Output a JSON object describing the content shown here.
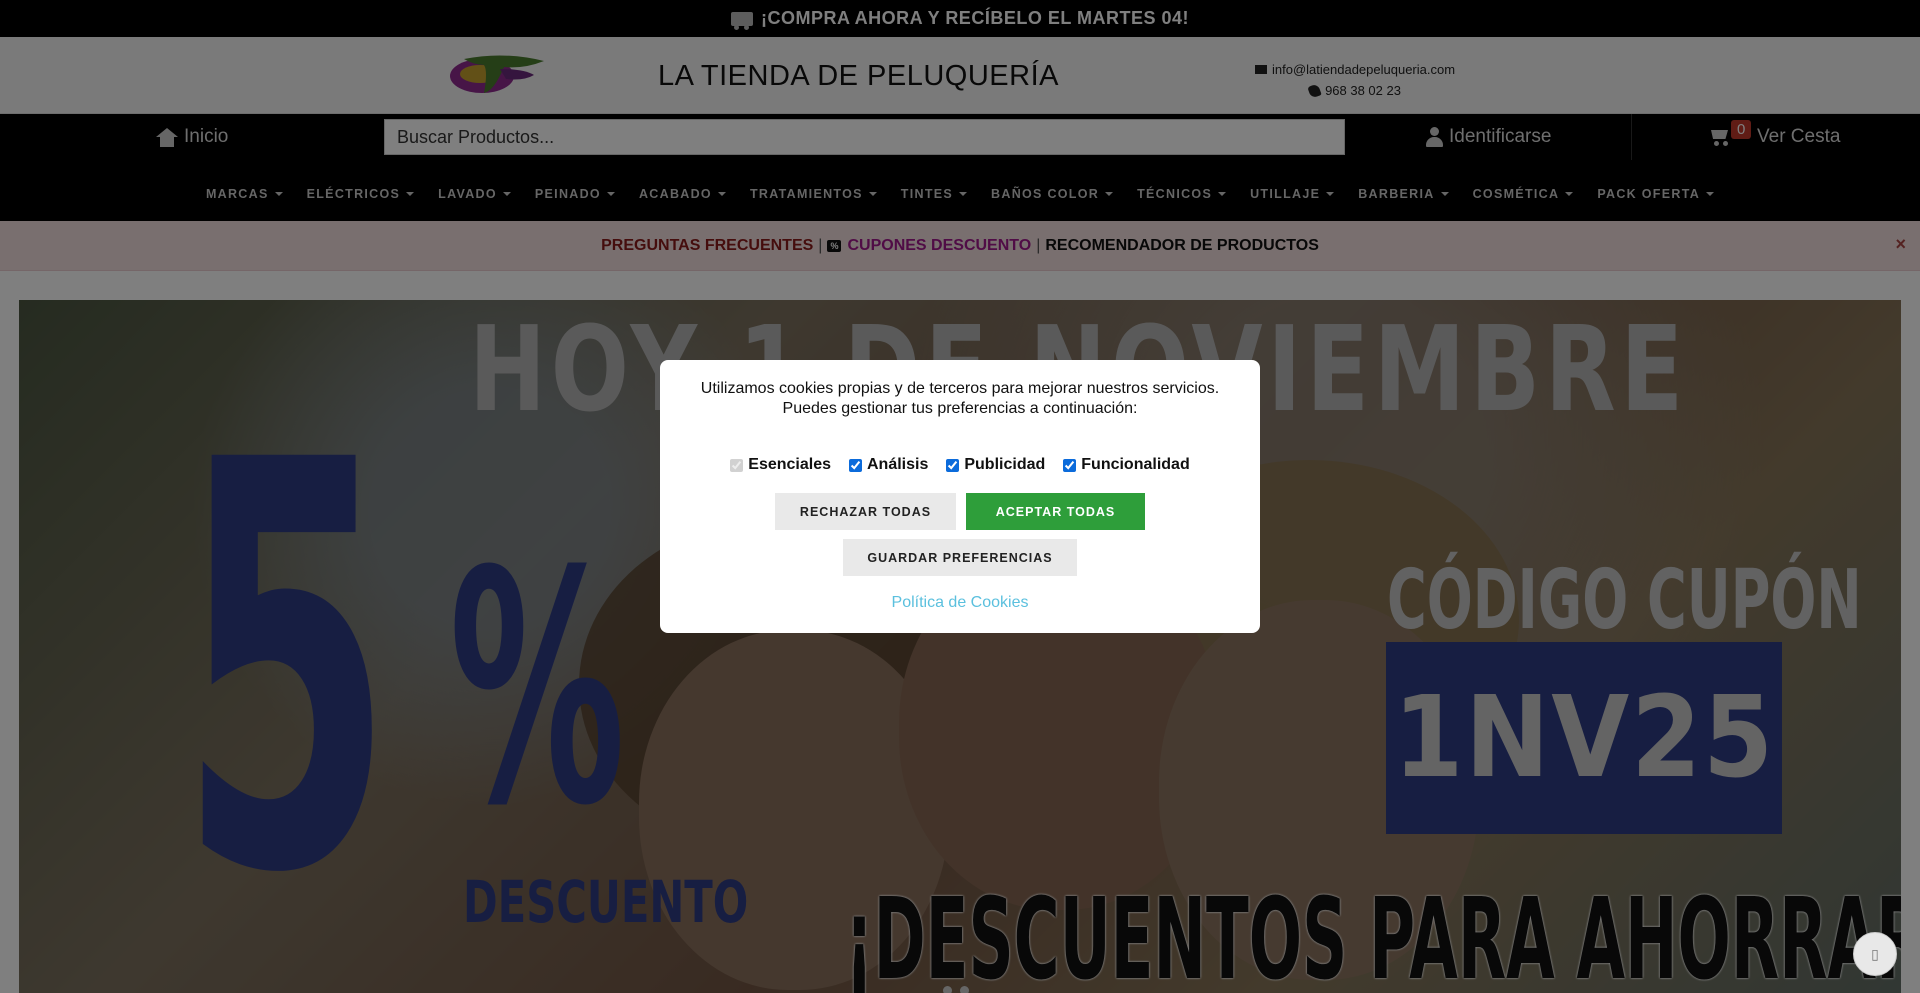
{
  "topbar": {
    "text": "¡COMPRA AHORA Y RECÍBELO EL MARTES 04!",
    "icon": "truck-icon"
  },
  "header": {
    "title": "LA TIENDA DE PELUQUERÍA",
    "email": "info@latiendadepeluqueria.com",
    "phone": "968 38 02 23"
  },
  "nav": {
    "home": "Inicio",
    "search_placeholder": "Buscar Productos...",
    "login": "Identificarse",
    "cart_label": "Ver Cesta",
    "cart_count": "0"
  },
  "menu": [
    "MARCAS",
    "ELÉCTRICOS",
    "LAVADO",
    "PEINADO",
    "ACABADO",
    "TRATAMIENTOS",
    "TINTES",
    "BAÑOS COLOR",
    "TÉCNICOS",
    "UTILLAJE",
    "BARBERIA",
    "COSMÉTICA",
    "PACK OFERTA"
  ],
  "promo": {
    "faq": "PREGUNTAS FRECUENTES",
    "separator": "|",
    "coupon_tag": "%",
    "coupons": "CUPONES DESCUENTO",
    "recommender": "RECOMENDADOR DE PRODUCTOS",
    "close": "×"
  },
  "hero": {
    "date": "HOY 1 DE NOVIEMBRE",
    "percent_number": "5",
    "percent_sign": "%",
    "discount": "DESCUENTO",
    "coupon_label": "CÓDIGO CUPÓN",
    "coupon_code": "1NV25",
    "tagline": "¡DESCUENTOS PARA AHORRAR!"
  },
  "cookie_modal": {
    "line1": "Utilizamos cookies propias y de terceros para mejorar nuestros servicios.",
    "line2": "Puedes gestionar tus preferencias a continuación:",
    "options": [
      {
        "label": "Esenciales",
        "checked": true,
        "disabled": true
      },
      {
        "label": "Análisis",
        "checked": true
      },
      {
        "label": "Publicidad",
        "checked": true
      },
      {
        "label": "Funcionalidad",
        "checked": true
      }
    ],
    "reject": "RECHAZAR TODAS",
    "accept": " ACEPTAR TODAS",
    "save": "GUARDAR PREFERENCIAS",
    "policy": "Política de Cookies"
  },
  "colors": {
    "accept_green": "#2e9e3a",
    "hero_blue": "#2f3d85",
    "cart_badge": "#c0392b"
  }
}
